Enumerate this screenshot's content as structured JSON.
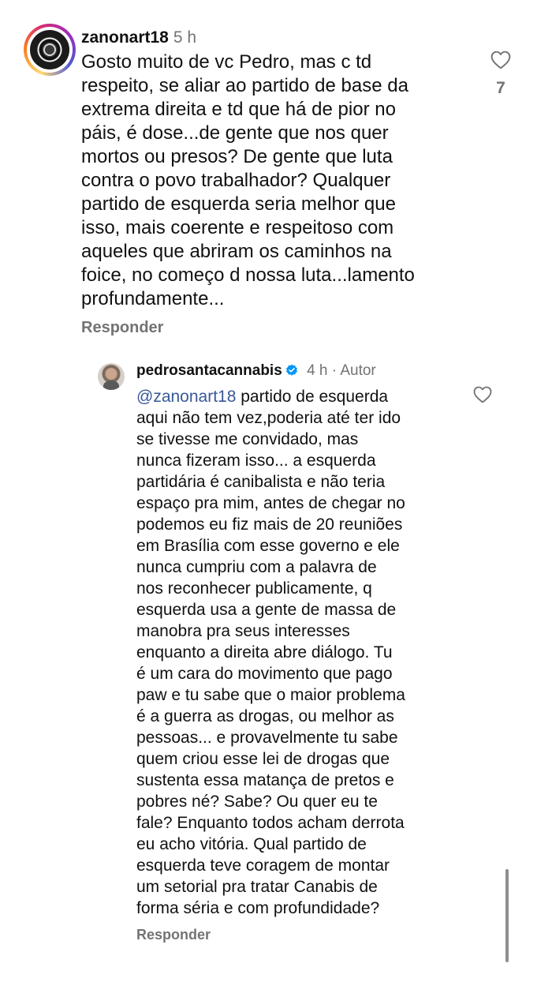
{
  "comments": [
    {
      "username": "zanonart18",
      "time": "5 h",
      "text": "Gosto muito de vc Pedro, mas c td\nrespeito, se aliar ao partido de base da\nextrema direita e td que há de pior no\npáis, é dose...de gente que nos quer\nmortos ou presos? De gente que luta\ncontra o povo trabalhador? Qualquer\npartido de esquerda seria melhor que\nisso, mais coerente e respeitoso com\naqueles que abriram os caminhos na\nfoice, no começo d nossa luta...lamento\nprofundamente...",
      "reply_label": "Responder",
      "like_count": "7",
      "like_icon": "heart-outline-icon"
    }
  ],
  "reply": {
    "username": "pedrosantacannabis",
    "verified": true,
    "time": "4 h",
    "separator": "·",
    "author_tag": "Autor",
    "mention": "@zanonart18",
    "text": " partido de esquerda\naqui não tem vez,poderia até ter ido\nse tivesse me convidado, mas\nnunca fizeram isso... a esquerda\npartidária é canibalista e não teria\nespaço pra mim, antes de chegar no\npodemos eu fiz mais de 20 reuniões\nem Brasília com esse governo e ele\nnunca cumpriu com a palavra de\nnos reconhecer publicamente, q\nesquerda usa a gente de massa de\nmanobra pra seus interesses\nenquanto a direita abre diálogo. Tu\né um cara do movimento que pago\npaw e tu sabe que o maior problema\né a guerra as drogas, ou melhor as\npessoas... e provavelmente tu sabe\nquem criou esse lei de drogas que\nsustenta essa matança de pretos e\npobres né? Sabe? Ou quer eu te\nfale? Enquanto todos acham derrota\neu acho vitória. Qual partido de\nesquerda teve coragem de montar\num setorial pra tratar Canabis de\nforma séria e com profundidade?",
    "reply_label": "Responder",
    "like_icon": "heart-outline-icon"
  },
  "colors": {
    "text": "#111111",
    "secondary": "#737373",
    "mention": "#385898",
    "verified": "#0095f6"
  }
}
